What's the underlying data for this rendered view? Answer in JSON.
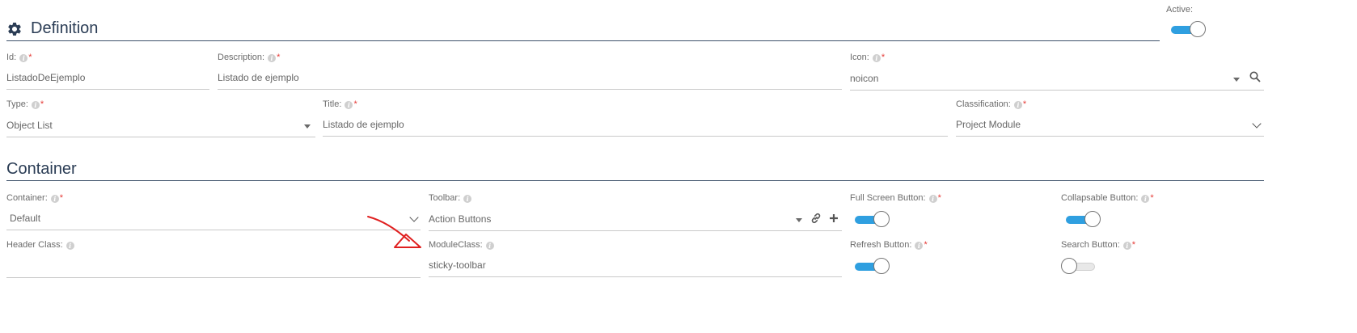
{
  "definition": {
    "title": "Definition",
    "active": {
      "label": "Active:",
      "on": true
    },
    "fields": {
      "id": {
        "label": "Id:",
        "value": "ListadoDeEjemplo"
      },
      "description": {
        "label": "Description:",
        "value": "Listado de ejemplo"
      },
      "icon": {
        "label": "Icon:",
        "value": "noicon"
      },
      "type": {
        "label": "Type:",
        "value": "Object List"
      },
      "title": {
        "label": "Title:",
        "value": "Listado de ejemplo"
      },
      "classification": {
        "label": "Classification:",
        "value": "Project Module"
      }
    }
  },
  "container": {
    "title": "Container",
    "fields": {
      "container": {
        "label": "Container:",
        "value": "Default"
      },
      "toolbar": {
        "label": "Toolbar:",
        "value": "Action Buttons"
      },
      "header_class": {
        "label": "Header Class:",
        "value": ""
      },
      "module_class": {
        "label": "ModuleClass:",
        "value": "sticky-toolbar"
      }
    },
    "toggles": {
      "full_screen": {
        "label": "Full Screen Button:",
        "on": true
      },
      "collapsable": {
        "label": "Collapsable Button:",
        "on": true
      },
      "refresh": {
        "label": "Refresh Button:",
        "on": true
      },
      "search": {
        "label": "Search Button:",
        "on": false
      }
    }
  },
  "info_glyph": "i",
  "required_mark": "*",
  "colors": {
    "accent": "#2f9fe0",
    "heading": "#2b3d55",
    "required": "#e53935",
    "annotation_arrow": "#e02020"
  },
  "icons": [
    "gear-icon",
    "search-icon",
    "link-icon",
    "plus-icon",
    "chevron-down-icon",
    "caret-down-icon",
    "info-icon",
    "arrow-annotation"
  ]
}
